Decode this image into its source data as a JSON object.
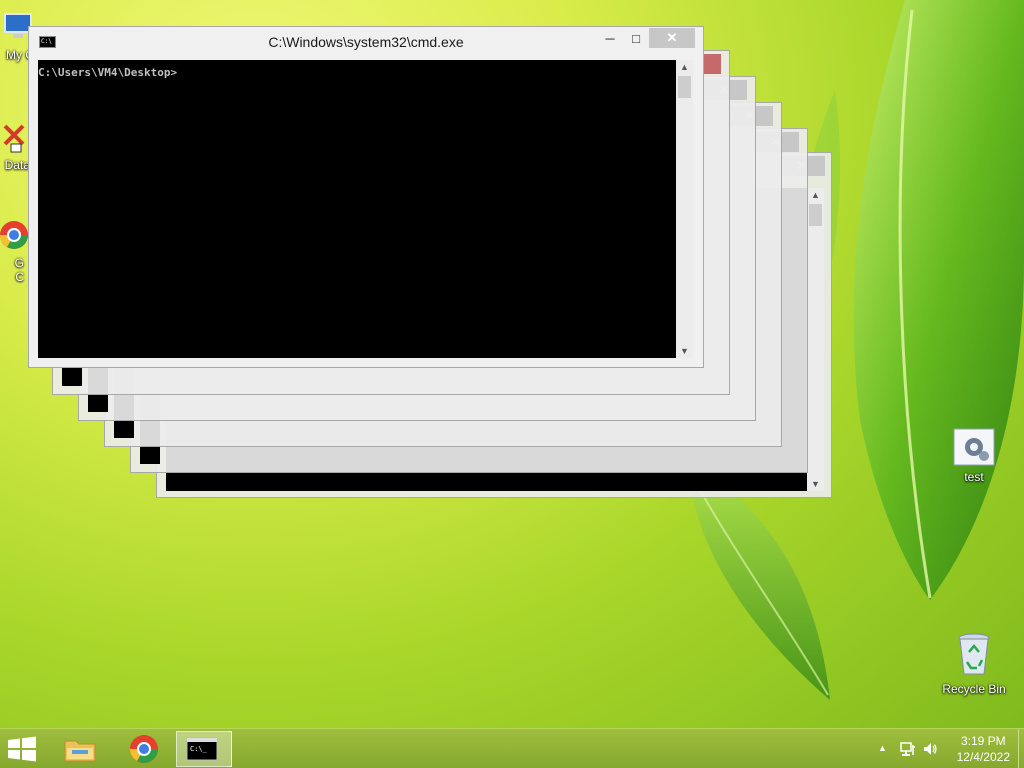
{
  "desktop": {
    "icons": [
      {
        "label": "My C",
        "icon": "computer-icon"
      },
      {
        "label": "Data",
        "icon": "database-shortcut-icon"
      },
      {
        "label": "G\nC",
        "icon": "chrome-shortcut-icon"
      },
      {
        "label": "test",
        "icon": "settings-file-icon"
      },
      {
        "label": "Recycle Bin",
        "icon": "recycle-bin-icon"
      }
    ]
  },
  "window": {
    "title": "C:\\Windows\\system32\\cmd.exe",
    "prompt": "C:\\Users\\VM4\\Desktop>",
    "minimize": "─",
    "maximize": "□",
    "close": "✕",
    "scroll_up": "▲",
    "scroll_down": "▼"
  },
  "taskbar": {
    "items": [
      {
        "name": "file-explorer",
        "icon": "folder-icon"
      },
      {
        "name": "chrome",
        "icon": "chrome-icon"
      },
      {
        "name": "command-prompt",
        "icon": "cmd-icon"
      }
    ],
    "tray": {
      "up_arrow": "▲",
      "network": "network-icon",
      "volume": "volume-icon",
      "time": "3:19 PM",
      "date": "12/4/2022"
    }
  },
  "colors": {
    "taskbar": "#8fb034",
    "console": "#000000",
    "close_button": "#c7c7c7"
  }
}
